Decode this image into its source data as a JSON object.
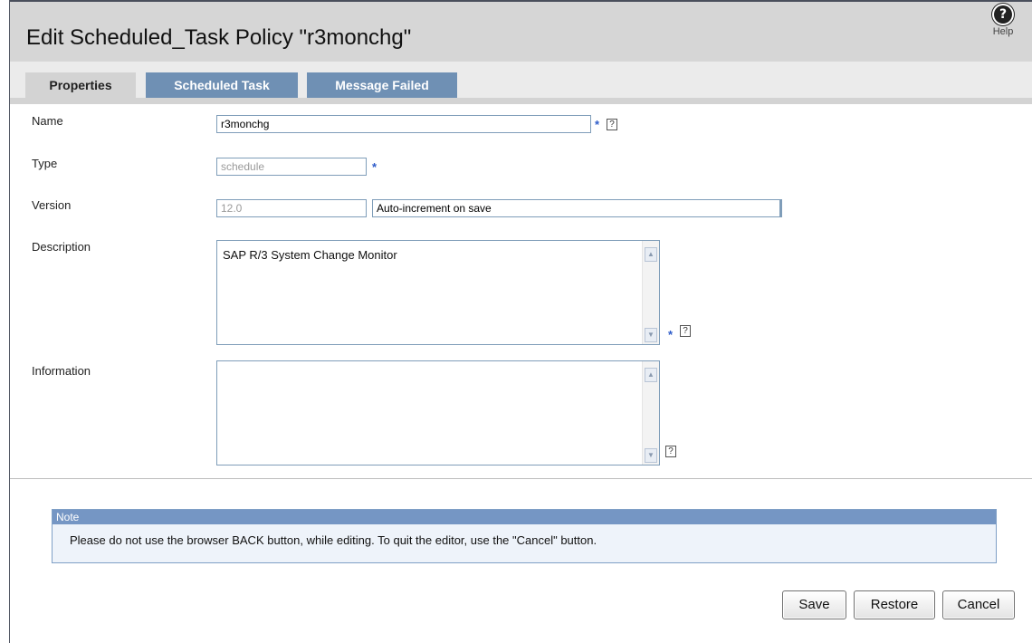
{
  "header": {
    "title": "Edit Scheduled_Task Policy \"r3monchg\"",
    "help_label": "Help"
  },
  "tabs": [
    {
      "label": "Properties",
      "active": true
    },
    {
      "label": "Scheduled Task",
      "active": false
    },
    {
      "label": "Message Failed",
      "active": false
    }
  ],
  "form": {
    "name": {
      "label": "Name",
      "value": "r3monchg"
    },
    "type": {
      "label": "Type",
      "value": "schedule"
    },
    "version": {
      "label": "Version",
      "value": "12.0",
      "mode": "Auto-increment on save"
    },
    "description": {
      "label": "Description",
      "value": "SAP R/3 System Change Monitor"
    },
    "information": {
      "label": "Information",
      "value": ""
    },
    "required_marker": "*",
    "help_marker": "?"
  },
  "note": {
    "heading": "Note",
    "text": "Please do not use the browser BACK button, while editing. To quit the editor, use the \"Cancel\" button."
  },
  "buttons": {
    "save": "Save",
    "restore": "Restore",
    "cancel": "Cancel"
  },
  "colors": {
    "header_bg": "#d6d6d6",
    "tab_bg": "#6f90b4",
    "note_head": "#7596c4",
    "required": "#2c5ac9"
  }
}
